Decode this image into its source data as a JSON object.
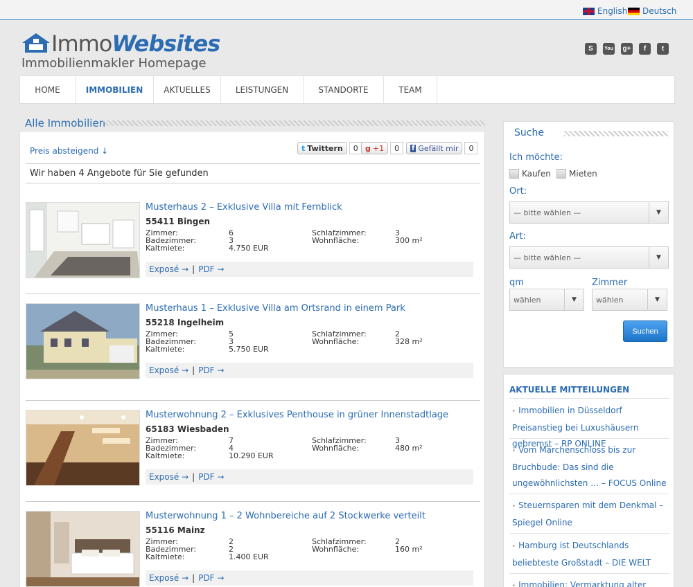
{
  "top_bar": {
    "lang_english": "English",
    "lang_deutsch": "Deutsch"
  },
  "brand": {
    "logo_part1": "Immo",
    "logo_part2": "Websites",
    "tagline": "Immobilienmakler Homepage"
  },
  "social_icons": [
    "skype-icon",
    "youtube-icon",
    "google-plus-icon",
    "facebook-icon",
    "twitter-icon"
  ],
  "nav": {
    "items": [
      {
        "label": "HOME"
      },
      {
        "label": "IMMOBILIEN"
      },
      {
        "label": "AKTUELLES"
      },
      {
        "label": "LEISTUNGEN"
      },
      {
        "label": "STANDORTE"
      },
      {
        "label": "TEAM"
      }
    ],
    "active": "IMMOBILIEN"
  },
  "main": {
    "section_title": "Alle Immobilien",
    "sort_label": "Preis absteigend ↓",
    "share": {
      "twitter_label": "Twittern",
      "twitter_count": "0",
      "gplus_label": "+1",
      "gplus_count": "0",
      "facebook_label": "Gefällt mir",
      "facebook_count": "0"
    },
    "results_text": "Wir haben 4 Angebote für Sie gefunden",
    "attr_labels": {
      "rooms": "Zimmer:",
      "bathrooms": "Badezimmer:",
      "rent": "Kaltmiete:",
      "bedrooms": "Schlafzimmer:",
      "living_area": "Wohnfläche:"
    },
    "actions": {
      "expose": "Exposé →",
      "separator": "|",
      "pdf": "PDF →"
    },
    "listings": [
      {
        "title": "Musterhaus 2 – Exklusive Villa mit Fernblick",
        "city": "55411 Bingen",
        "rooms": "6",
        "bathrooms": "3",
        "rent": "4.750 EUR",
        "bedrooms": "3",
        "living_area": "300 m²"
      },
      {
        "title": "Musterhaus 1 – Exklusive Villa am Ortsrand in einem Park",
        "city": "55218 Ingelheim",
        "rooms": "5",
        "bathrooms": "3",
        "rent": "5.750 EUR",
        "bedrooms": "2",
        "living_area": "328 m²"
      },
      {
        "title": "Musterwohnung 2 – Exklusives Penthouse in grüner Innenstadtlage",
        "city": "65183 Wiesbaden",
        "rooms": "7",
        "bathrooms": "4",
        "rent": "10.290 EUR",
        "bedrooms": "3",
        "living_area": "480 m²"
      },
      {
        "title": "Musterwohnung 1 – 2 Wohnbereiche auf 2 Stockwerke verteilt",
        "city": "55116 Mainz",
        "rooms": "2",
        "bathrooms": "2",
        "rent": "1.400 EUR",
        "bedrooms": "2",
        "living_area": "160 m²"
      }
    ]
  },
  "search": {
    "title": "Suche",
    "want_label": "Ich möchte:",
    "buy_label": "Kaufen",
    "rent_label": "Mieten",
    "location_label": "Ort:",
    "location_value": "— bitte wählen —",
    "type_label": "Art:",
    "type_value": "— bitte wählen —",
    "sqm_label": "qm",
    "sqm_value": "wählen",
    "rooms_label": "Zimmer",
    "rooms_value": "wählen",
    "submit_label": "Suchen"
  },
  "news": {
    "title": "AKTUELLE MITTEILUNGEN",
    "items": [
      "Immobilien in Düsseldorf Preisanstieg bei Luxushäusern gebremst – RP ONLINE",
      "Vom Märchenschloss bis zur Bruchbude: Das sind die ungewöhnlichsten … – FOCUS Online",
      "Steuernsparen mit dem Denkmal – Spiegel Online",
      "Hamburg ist Deutschlands beliebteste Großstadt – DIE WELT",
      "Immobilien: Vermarktung alter Hertie-"
    ]
  }
}
